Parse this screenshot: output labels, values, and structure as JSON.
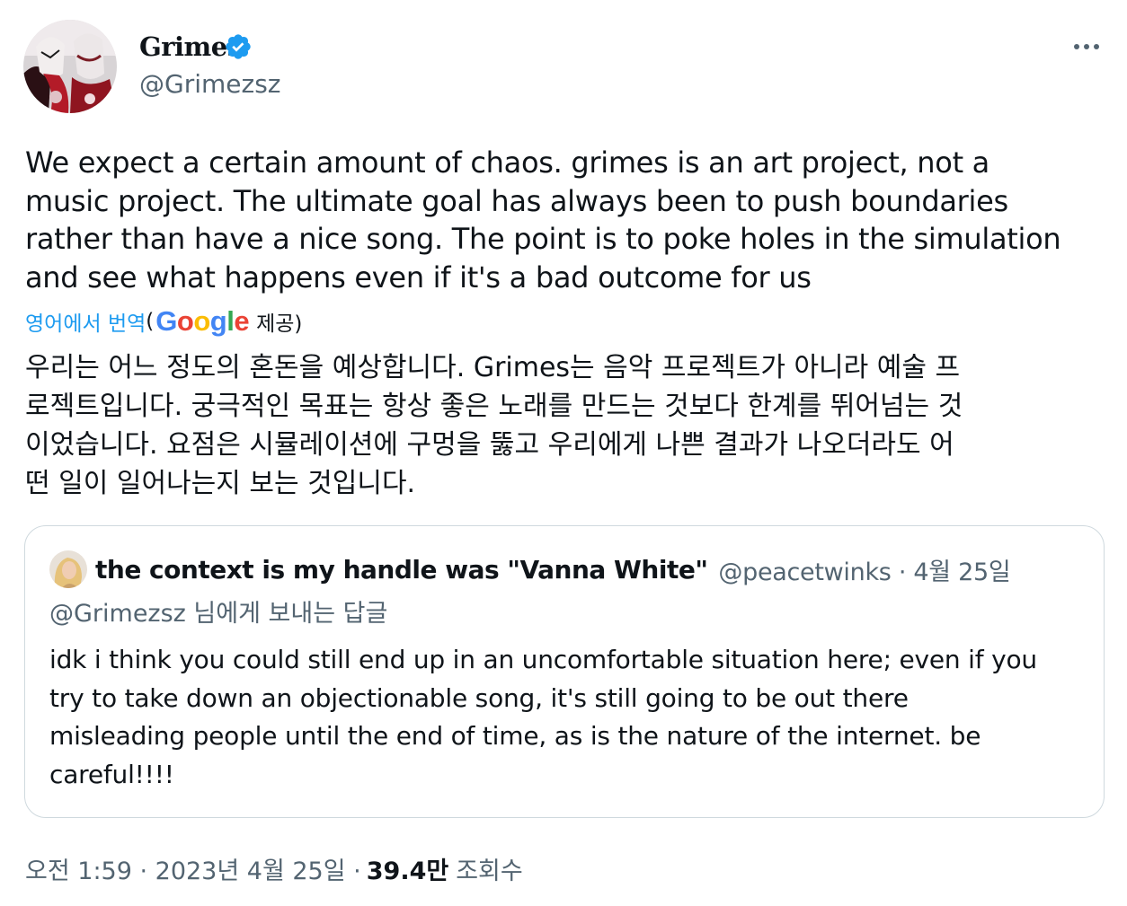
{
  "author": {
    "display_name": "Grimes",
    "handle": "@Grimezsz",
    "verified_icon": "verified-badge-icon"
  },
  "tweet": {
    "text": "We expect a certain amount of chaos. grimes is an art project, not a\nmusic project.  The ultimate goal has always been to push boundaries\nrather than have a nice song. The point is to poke holes in the simulation\nand see what happens even if it's a bad outcome for us",
    "translate_label": "영어에서 번역",
    "provider_open": "(",
    "provider_name": "Google",
    "provider_suffix": "제공)",
    "translated_text": "우리는 어느 정도의 혼돈을 예상합니다. Grimes는 음악 프로젝트가 아니라 예술 프\n로젝트입니다. 궁극적인 목표는 항상 좋은 노래를 만드는 것보다 한계를 뛰어넘는 것\n이었습니다. 요점은 시뮬레이션에 구멍을 뚫고 우리에게 나쁜 결과가 나오더라도 어\n떤 일이 일어나는지 보는 것입니다."
  },
  "quoted_tweet": {
    "display_name": "the context is my handle was \"Vanna White\"",
    "meta": "@peacetwinks · 4월 25일",
    "reply_to": "@Grimezsz 님에게 보내는 답글",
    "text": "idk i think you could still end up in an uncomfortable situation here; even if you\ntry to take down an objectionable song, it's still going to be out there\nmisleading people until the end of time, as is the nature of the internet. be\ncareful!!!!"
  },
  "footer": {
    "timestamp": "오전 1:59 · 2023년 4월 25일 ·",
    "views_count": "39.4만",
    "views_label": "조회수"
  },
  "colors": {
    "accent": "#1d9bf0",
    "text_primary": "#0f1419",
    "text_secondary": "#536471",
    "border": "#cfd9de"
  }
}
